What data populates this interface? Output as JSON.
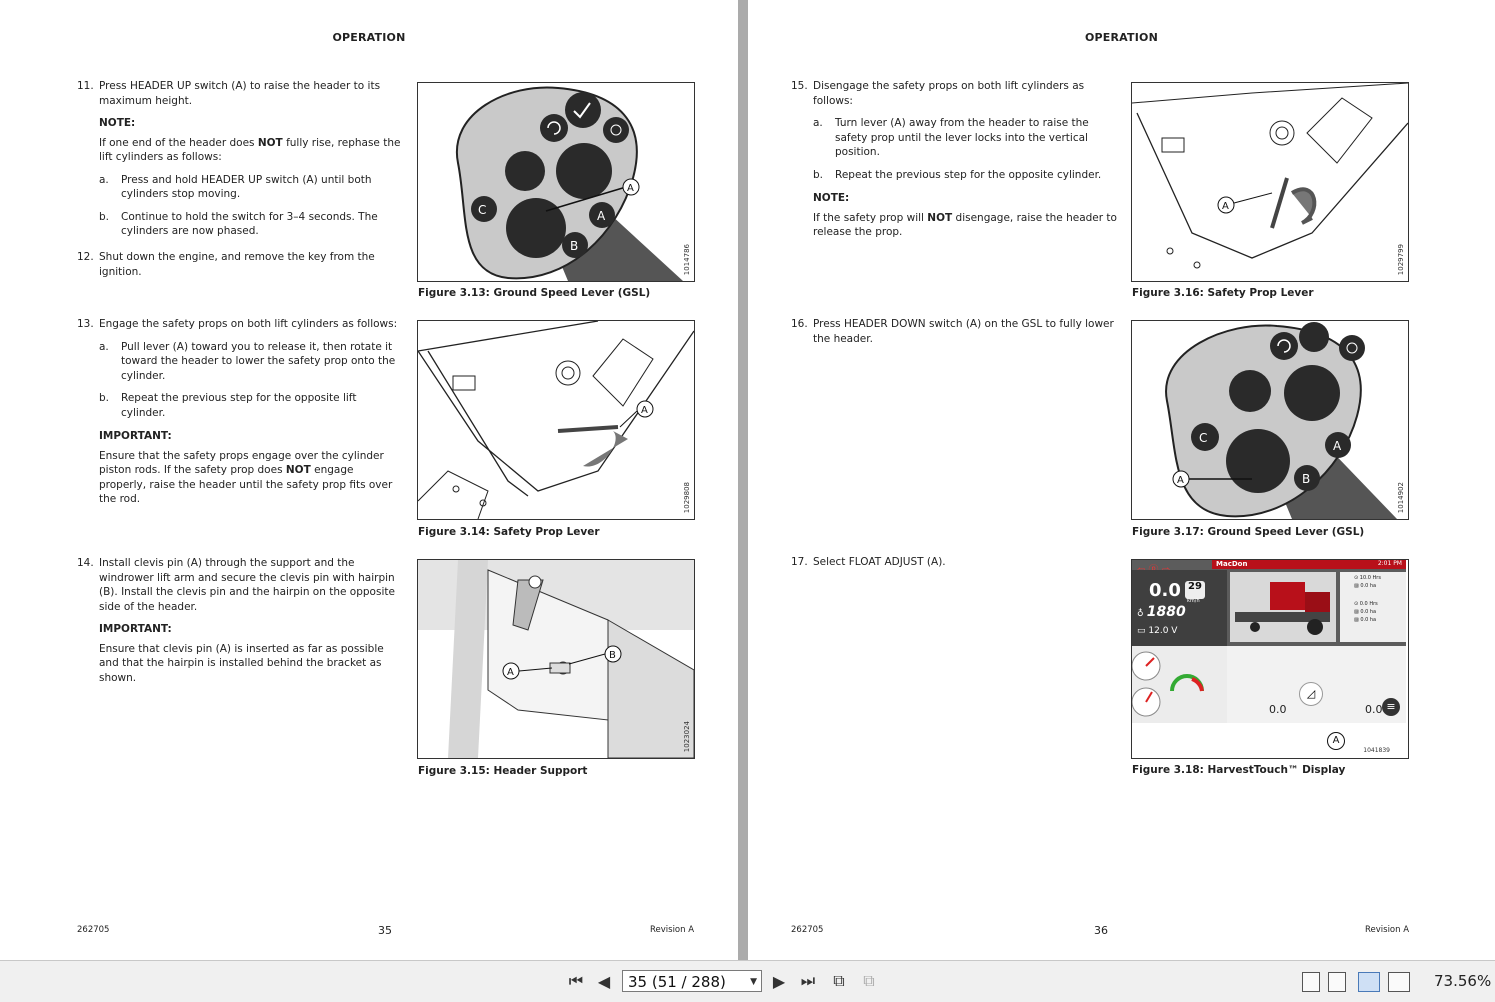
{
  "left_page": {
    "header": "OPERATION",
    "step11": {
      "num": "11.",
      "text": "Press HEADER UP switch (A) to raise the header to its maximum height.",
      "note_label": "NOTE:",
      "note_pre": "If one end of the header does ",
      "note_bold": "NOT",
      "note_post": " fully rise, rephase the lift cylinders as follows:",
      "a_letter": "a.",
      "a_text": "Press and hold HEADER UP switch (A) until both cylinders stop moving.",
      "b_letter": "b.",
      "b_text": "Continue to hold the switch for 3–4 seconds. The cylinders are now phased."
    },
    "step12": {
      "num": "12.",
      "text": "Shut down the engine, and remove the key from the ignition."
    },
    "step13": {
      "num": "13.",
      "text": "Engage the safety props on both lift cylinders as follows:",
      "a_letter": "a.",
      "a_text": "Pull lever (A) toward you to release it, then rotate it toward the header to lower the safety prop onto the cylinder.",
      "b_letter": "b.",
      "b_text": "Repeat the previous step for the opposite lift cylinder.",
      "imp_label": "IMPORTANT:",
      "imp_pre": "Ensure that the safety props engage over the cylinder piston rods. If the safety prop does ",
      "imp_bold": "NOT",
      "imp_post": " engage properly, raise the header until the safety prop fits over the rod."
    },
    "step14": {
      "num": "14.",
      "text": "Install clevis pin (A) through the support and the windrower lift arm and secure the clevis pin with hairpin (B). Install the clevis pin and the hairpin on the opposite side of the header.",
      "imp_label": "IMPORTANT:",
      "imp_text": "Ensure that clevis pin (A) is inserted as far as possible and that the hairpin is installed behind the bracket as shown."
    },
    "fig13": {
      "caption": "Figure 3.13: Ground Speed Lever (GSL)",
      "id": "1014786"
    },
    "fig14": {
      "caption": "Figure 3.14: Safety Prop Lever",
      "id": "1029808"
    },
    "fig15": {
      "caption": "Figure 3.15: Header Support",
      "id": "1023024"
    },
    "footer_left": "262705",
    "page_number": "35",
    "footer_right": "Revision  A"
  },
  "right_page": {
    "header": "OPERATION",
    "step15": {
      "num": "15.",
      "text": "Disengage the safety props on both lift cylinders as follows:",
      "a_letter": "a.",
      "a_text": "Turn lever (A) away from the header to raise the safety prop until the lever locks into the vertical position.",
      "b_letter": "b.",
      "b_text": "Repeat the previous step for the opposite cylinder.",
      "note_label": "NOTE:",
      "note_pre": "If the safety prop will ",
      "note_bold": "NOT",
      "note_post": " disengage, raise the header to release the prop."
    },
    "step16": {
      "num": "16.",
      "text": "Press HEADER DOWN switch (A) on the GSL to fully lower the header."
    },
    "step17": {
      "num": "17.",
      "text": "Select FLOAT ADJUST (A)."
    },
    "fig16": {
      "caption": "Figure 3.16: Safety Prop Lever",
      "id": "1029799"
    },
    "fig17": {
      "caption": "Figure 3.17: Ground Speed Lever (GSL)",
      "id": "1014902"
    },
    "fig18": {
      "caption": "Figure 3.18: HarvestTouch™ Display",
      "id": "1041839",
      "brand": "MacDon",
      "time": "2:01 PM",
      "speed": "0.0",
      "speed_max": "29",
      "speed_unit": "km/h",
      "rpm": "1880",
      "voltage": "12.0 V",
      "hrs1": "10.0 Hrs",
      "ha1": "0.0 ha",
      "hrs2": "0.0 Hrs",
      "ha2": "0.0 ha",
      "ha3": "0.0 ha",
      "float_left": "0.0",
      "float_right": "0.0"
    },
    "footer_left": "262705",
    "page_number": "36",
    "footer_right": "Revision  A"
  },
  "toolbar": {
    "page_field": "35 (51 / 288)",
    "zoom": "73.56%"
  },
  "callouts": {
    "A": "A",
    "B": "B",
    "C": "C"
  }
}
